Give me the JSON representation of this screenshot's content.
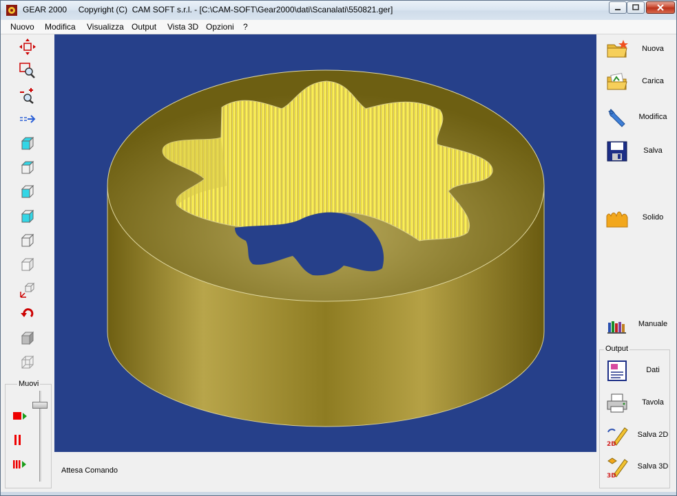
{
  "window": {
    "title": "GEAR 2000     Copyright (C)  CAM SOFT s.r.l. - [C:\\CAM-SOFT\\Gear2000\\dati\\Scanalati\\550821.ger]"
  },
  "menu": [
    "Nuovo",
    "Modifica",
    "Visualizza",
    "Output",
    "Vista 3D",
    "Opzioni",
    "?"
  ],
  "left_toolbar": {
    "motion_group_label": "Muovi"
  },
  "status": {
    "text": "Attesa Comando"
  },
  "right_panel": {
    "buttons": [
      "Nuova",
      "Carica",
      "Modifica",
      "Salva",
      "Solido",
      "Manuale"
    ],
    "output_group_label": "Output",
    "output_buttons": [
      "Dati",
      "Tavola",
      "Salva 2D",
      "Salva 3D"
    ]
  },
  "colors": {
    "viewport_background": "#26408a",
    "gear_gold": "#b3a043",
    "tooth_yellow": "#f2e33a"
  }
}
